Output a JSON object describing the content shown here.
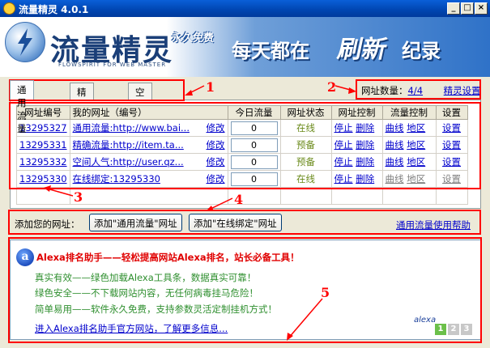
{
  "window": {
    "title": "流量精灵 4.0.1"
  },
  "banner": {
    "logo_text": "流量精灵",
    "logo_tag": "永久免费",
    "logo_sub": "FLOWSPIRIT FOR WEB MASTER",
    "slogan_a": "每天都在",
    "slogan_b": "刷新",
    "slogan_c": "纪录"
  },
  "tabs": [
    {
      "label": "通用流量",
      "active": true
    },
    {
      "label": "精确流量",
      "active": false
    },
    {
      "label": "空间人气",
      "active": false
    }
  ],
  "site_count": {
    "label": "网址数量：",
    "value": "4/4",
    "settings_link": "精灵设置"
  },
  "table": {
    "headers": [
      "网址编号",
      "我的网址（编号）",
      "今日流量",
      "网址状态",
      "网址控制",
      "流量控制",
      "设置"
    ],
    "rows": [
      {
        "id": "13295327",
        "url": "通用流量:http://www.bai...",
        "edit": "修改",
        "traffic": "0",
        "status": "在线",
        "stop": "停止",
        "del": "删除",
        "curve": "曲线",
        "region": "地区",
        "settings": "设置",
        "disabled": false
      },
      {
        "id": "13295331",
        "url": "精确流量:http://item.ta...",
        "edit": "修改",
        "traffic": "0",
        "status": "预备",
        "stop": "停止",
        "del": "删除",
        "curve": "曲线",
        "region": "地区",
        "settings": "设置",
        "disabled": false
      },
      {
        "id": "13295332",
        "url": "空间人气:http://user.qz...",
        "edit": "修改",
        "traffic": "0",
        "status": "预备",
        "stop": "停止",
        "del": "删除",
        "curve": "曲线",
        "region": "地区",
        "settings": "设置",
        "disabled": false
      },
      {
        "id": "13295330",
        "url": "在线绑定:13295330",
        "edit": "修改",
        "traffic": "0",
        "status": "在线",
        "stop": "停止",
        "del": "删除",
        "curve": "曲线",
        "region": "地区",
        "settings": "设置",
        "disabled": true
      }
    ]
  },
  "add": {
    "label": "添加您的网址：",
    "btn_general": "添加\"通用流量\"网址",
    "btn_bind": "添加\"在线绑定\"网址",
    "help": "通用流量使用帮助"
  },
  "ad": {
    "icon": "a",
    "title": "Alexa排名助手——轻松提高网站Alexa排名，站长必备工具！",
    "lines": [
      "真实有效——绿色加载Alexa工具条，数据真实可靠！",
      "绿色安全——不下载网站内容，无任何病毒挂马危险！",
      "简单易用——软件永久免费，支持参数灵活定制挂机方式！"
    ],
    "link": "进入Alexa排名助手官方网站，了解更多信息...",
    "brand": "alexa",
    "pages": [
      "1",
      "2",
      "3"
    ]
  },
  "annotations": [
    "1",
    "2",
    "3",
    "4",
    "5"
  ],
  "colors": {
    "annotation": "#ff0000",
    "link": "#0000cc",
    "status_green": "#6a8a1a",
    "ad_title": "#e00000",
    "ad_text": "#2f8f2f"
  }
}
